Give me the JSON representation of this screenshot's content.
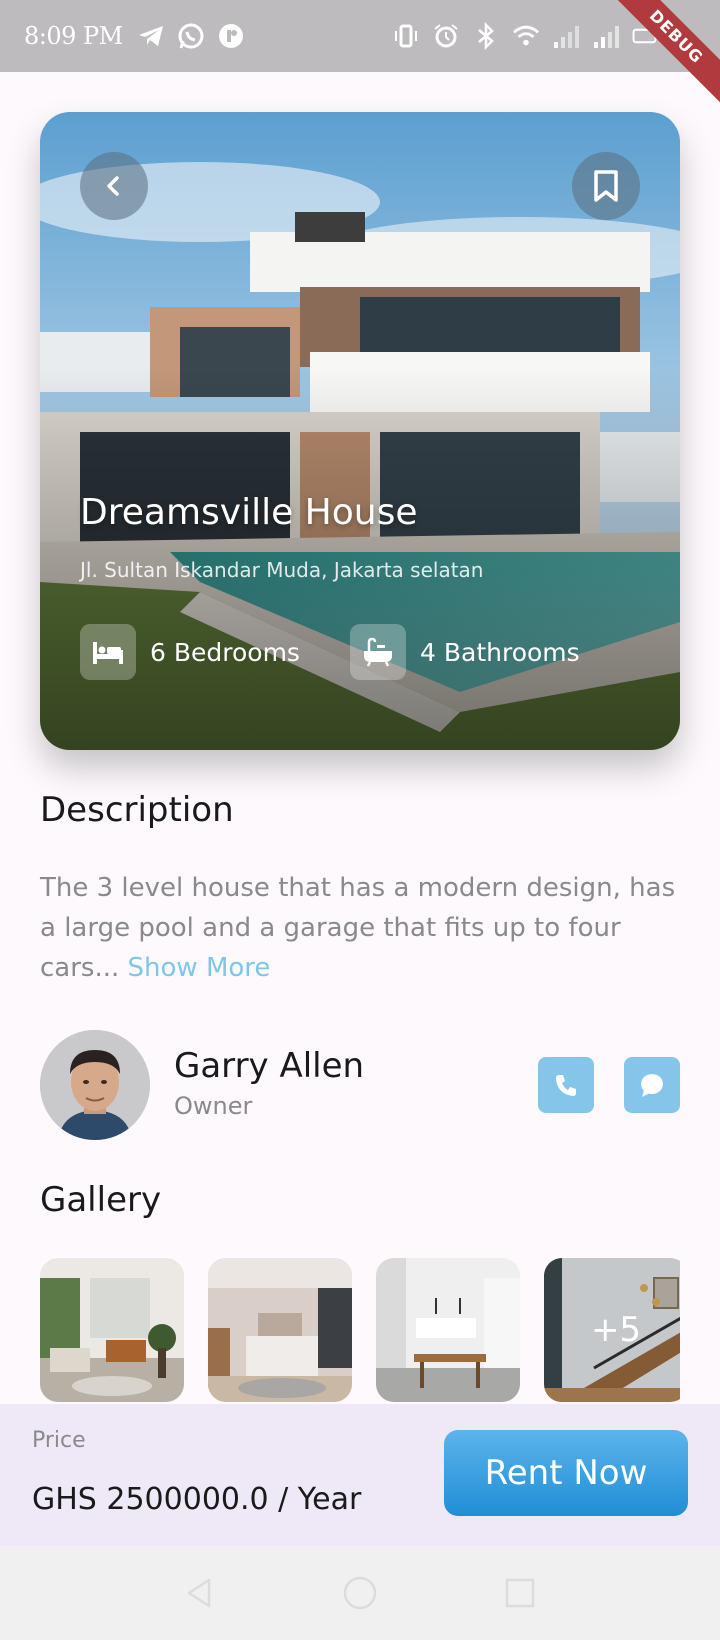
{
  "status_bar": {
    "time": "8:09 PM",
    "left_icons": [
      "telegram-icon",
      "whatsapp-icon",
      "app-icon"
    ],
    "right_icons": [
      "vibrate-icon",
      "alarm-icon",
      "bluetooth-icon",
      "wifi-icon",
      "signal-icon",
      "signal-icon-2",
      "battery-icon"
    ],
    "debug_label": "DEBUG"
  },
  "property": {
    "name": "Dreamsville House",
    "address": "Jl. Sultan Iskandar Muda, Jakarta selatan",
    "bedrooms": "6 Bedrooms",
    "bathrooms": "4 Bathrooms"
  },
  "description": {
    "heading": "Description",
    "text": "The 3 level house that has a modern design, has a large pool and a garage that fits up to four cars...",
    "show_more": "Show More"
  },
  "owner": {
    "name": "Garry Allen",
    "role": "Owner"
  },
  "gallery": {
    "heading": "Gallery",
    "more_count": "+5"
  },
  "bottom": {
    "price_label": "Price",
    "price_value": "GHS 2500000.0 / Year",
    "cta_label": "Rent Now"
  },
  "colors": {
    "accent": "#86c5ea",
    "cta": "#2a96dc",
    "background": "#fdf9fd",
    "bottom_bar": "#efe8f7"
  }
}
